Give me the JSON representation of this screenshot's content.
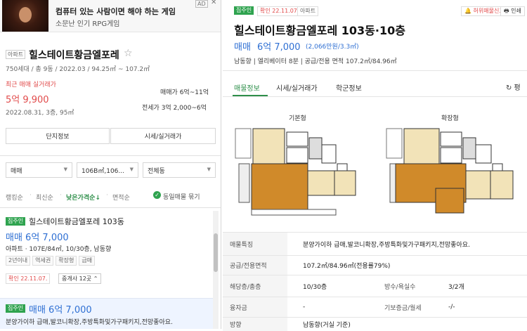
{
  "ad": {
    "title": "컴퓨터 있는 사람이면 해야 하는 게임",
    "subtitle": "소문난 인기 RPG게임",
    "badge": "AD",
    "close": "✕"
  },
  "complex": {
    "type_tag": "아파트",
    "name": "힐스테이트황금엘포레",
    "star": "☆",
    "info": "750세대 / 총 9동 / 2022.03 / 94.25㎡ ~ 107.2㎡",
    "recent_label": "최근 매매 실거래가",
    "recent_price": "5억 9,900",
    "recent_date": "2022.08.31, 3층, 95㎡",
    "sale_range": "매매가 6억~11억",
    "lease_range": "전세가 3억 2,000~6억",
    "btn_info": "단지정보",
    "btn_market": "시세/실거래가"
  },
  "filters": {
    "type": "매매",
    "area": "106B㎡,106...",
    "dong": "전체동",
    "arrow": "▼"
  },
  "sort": {
    "rank": "랭킹순",
    "newest": "최신순",
    "price": "낮은가격순↓",
    "area": "면적순",
    "dot": "·",
    "check_icon": "✓",
    "same_label": "동일매물 묶기"
  },
  "listing1": {
    "tag": "집주인",
    "name": "힐스테이트황금엘포레 103동",
    "price": "매매 6억 7,000",
    "detail": "아파트 · 107E/84㎡, 10/30층, 남동향",
    "features": [
      "2년이내",
      "역세권",
      "확장형",
      "급매"
    ],
    "confirm": "확인 22.11.07.",
    "broker": "중개사 12곳 ⌃"
  },
  "listing2": {
    "tag": "집주인",
    "price": "매매 6억 7,000",
    "desc": "분양가이하 급매,발코니확장,주방특화및가구패키지,전망좋아요."
  },
  "detail": {
    "tag": "집주인",
    "confirm": "확인 22.11.07.",
    "type": "아파트",
    "report": "🔔 허위매물신고",
    "print": "🖶 인쇄",
    "title": "힐스테이트황금엘포레 103동·10층",
    "price_label": "매매",
    "price": "6억 7,000",
    "price_per_area": "(2,066만원/3.3㎡)",
    "meta": "남동향  |  엘리베이터 8분  |  공급/전용 면적 107.2㎡/84.96㎡",
    "tabs": [
      "매물정보",
      "시세/실거래가",
      "학군정보"
    ],
    "refresh": "↻ 평",
    "plan_basic": "기본형",
    "plan_ext": "확장형",
    "rows": [
      {
        "k": "매물특징",
        "v": "분양가이하 급매,발코니확장,주방특화및가구패키지,전망좋아요."
      },
      {
        "k": "공급/전용면적",
        "v": "107.2㎡/84.96㎡(전용률79%)"
      },
      {
        "k": "해당층/총층",
        "v": "10/30층",
        "k2": "방수/욕실수",
        "v2": "3/2개"
      },
      {
        "k": "융자금",
        "v": "-",
        "k2": "기보증금/월세",
        "v2": "-/-"
      },
      {
        "k": "방향",
        "v": "남동향(거실 기준)"
      }
    ]
  },
  "colors": {
    "accent_green": "#2e8f4a",
    "price_blue": "#2e6fd3",
    "red": "#e14b4b"
  }
}
